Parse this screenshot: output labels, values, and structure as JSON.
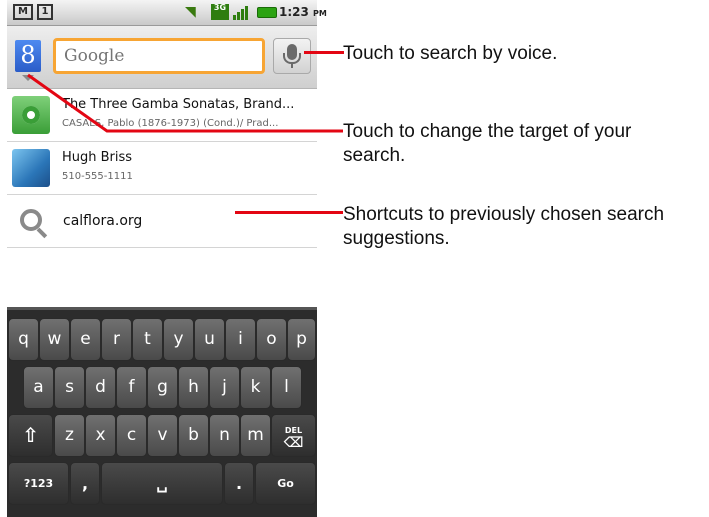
{
  "status_bar": {
    "notification_icons": [
      "gmail-icon",
      "calendar-icon"
    ],
    "gmail_glyph": "M",
    "calendar_glyph": "1",
    "network_label": "3G",
    "time": "1:23",
    "time_suffix": "PM"
  },
  "search_bar": {
    "source_glyph": "8",
    "placeholder": "Google",
    "voice_icon": "mic-icon"
  },
  "suggestions": [
    {
      "title": "The Three Gamba Sonatas, Brand...",
      "subtitle": "CASALS, Pablo (1876-1973) (Cond.)/ Prad...",
      "icon": "music-icon"
    },
    {
      "title": "Hugh Briss",
      "subtitle": "510-555-1111",
      "icon": "contact-photo"
    },
    {
      "title": "calflora.org",
      "icon": "search-icon"
    }
  ],
  "keyboard": {
    "row1": [
      "q",
      "w",
      "e",
      "r",
      "t",
      "y",
      "u",
      "i",
      "o",
      "p"
    ],
    "row2": [
      "a",
      "s",
      "d",
      "f",
      "g",
      "h",
      "j",
      "k",
      "l"
    ],
    "row3": [
      "z",
      "x",
      "c",
      "v",
      "b",
      "n",
      "m"
    ],
    "shift_glyph": "⇧",
    "del_label": "DEL",
    "del_glyph": "⌫",
    "symbols_label": "?123",
    "comma": ",",
    "space_glyph": "␣",
    "period": ".",
    "go_label": "Go"
  },
  "callouts": {
    "voice": "Touch to search by voice.",
    "target_line1": "Touch to change the target of your",
    "target_line2": "search.",
    "shortcuts_line1": "Shortcuts to previously chosen search",
    "shortcuts_line2": "suggestions."
  },
  "colors": {
    "callout_line": "#e30613",
    "input_focus": "#f7a534",
    "google_blue": "#2a5cc8"
  }
}
